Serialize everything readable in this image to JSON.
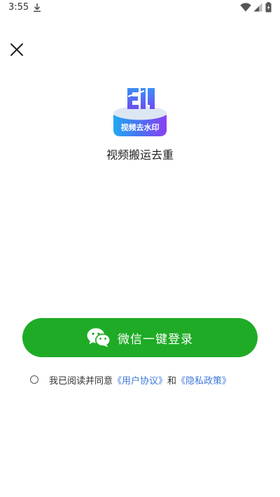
{
  "status_bar": {
    "time": "3:55",
    "icons": [
      "download-icon",
      "wifi-icon",
      "signal-icon",
      "battery-icon"
    ]
  },
  "header": {
    "close_icon": "close-icon"
  },
  "app": {
    "logo_text": "视频去水印",
    "name": "视频搬运去重"
  },
  "login": {
    "wechat_label": "微信一键登录",
    "button_color": "#1fab26"
  },
  "agreement": {
    "prefix": "我已阅读并同意",
    "user_agreement": "《用户协议》",
    "and_text": "和",
    "privacy_policy": "《隐私政策》",
    "checked": false,
    "link_color": "#3c78d8"
  }
}
